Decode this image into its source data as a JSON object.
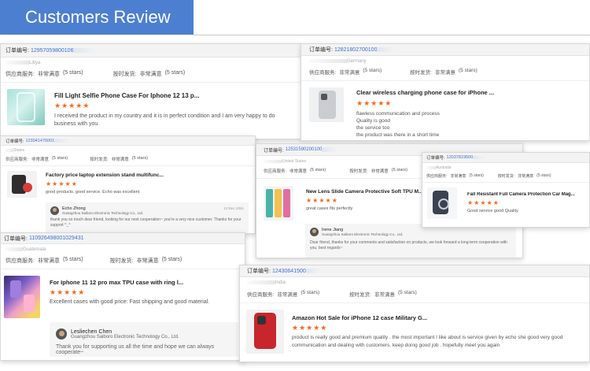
{
  "banner": {
    "title": "Customers Review"
  },
  "labels": {
    "order_no": "订单编号:",
    "service": "供应商服务:",
    "service_val": "非常满意",
    "service_stars": "(5 stars)",
    "ontime": "按时发货:",
    "ontime_val": "非常满意",
    "ontime_stars": "(5 stars)"
  },
  "reviews": {
    "r1": {
      "order": "12957059800106",
      "country": "Libya",
      "title": "Fill Light Selfie Phone Case For Iphone 12 13 p...",
      "stars": "★★★★★",
      "text": "I received the product in my country and it is in perfect condition and I am very happy to do business with you"
    },
    "r2": {
      "order": "12821802700100",
      "country": "Germany",
      "title": "Clear wireless charging phone case for iPhone ...",
      "stars": "★★★★★",
      "lines": [
        "flawless communication and process",
        "Quality is good",
        "the service too",
        "the product was there in a short time"
      ]
    },
    "r3": {
      "order": "123041476001",
      "country": "States",
      "title": "Factory price laptop extension stand multifunc...",
      "stars": "★★★★★",
      "text": "good products. good service. Echo was excellent",
      "reply": {
        "name": "Echo Zhong",
        "company": "Guangzhou Saiboro Electronic Technology Co., Ltd.",
        "date": "13 Dec 2021",
        "text": "thank you so much dear friend, looking for our next cooperation~ you're  a very nice customer. Thanks for your support ^_^"
      }
    },
    "r4": {
      "order": "12531590200100",
      "country": "United States",
      "title": "New Lens Slide Camera Protective Soft TPU M...",
      "stars": "★★★★★",
      "text": "great cases fits perfectly",
      "reply": {
        "name": "Irene Jiang",
        "company": "Guangzhou Saiboro Electronic Technology Co., Ltd.",
        "text": "Dear friend, thanks for your comments and satisfaction on products, we look forward a long-term cooperation with you, best regards~"
      }
    },
    "r5": {
      "order": "12037819500",
      "country": "Australia",
      "title": "Fall Resistant Full Camera Protection Car Mag...",
      "stars": "★★★★★",
      "text": "Good service good Quality"
    },
    "r6": {
      "order": "110926498001029431",
      "country": "Guatemala",
      "title": "For Iphone 11 12 pro max TPU case with ring l...",
      "stars": "★★★★★",
      "text": "Excellent cases with good price: Fast shipping and good material.",
      "reply": {
        "name": "Lesliechen Chen",
        "company": "Guangzhou Saiboro Electronic Technology Co., Ltd.",
        "text": "Thank you for supporting us all the time and hope we can always cooperate~"
      }
    },
    "r7": {
      "order": "12430641500",
      "country": "India",
      "title": "Amazon Hot Sale for iPhone 12 case Military G...",
      "stars": "★★★★★",
      "text": "product is really good and premium quality . the most important I like about is service given by echo she good very good communication and dealing with customers. keep doing good job . hopefully meet you again"
    }
  }
}
